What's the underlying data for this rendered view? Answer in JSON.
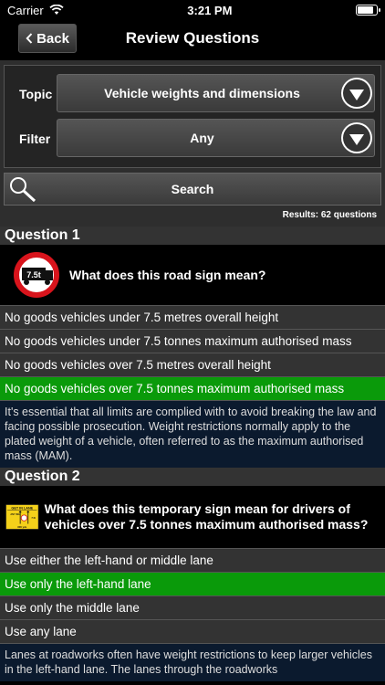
{
  "status": {
    "carrier": "Carrier",
    "time": "3:21 PM"
  },
  "nav": {
    "back_label": "Back",
    "title": "Review Questions"
  },
  "filters": {
    "topic_label": "Topic",
    "topic_value": "Vehicle weights and dimensions",
    "filter_label": "Filter",
    "filter_value": "Any"
  },
  "search": {
    "label": "Search"
  },
  "results_text": "Results: 62 questions",
  "questions": [
    {
      "header": "Question 1",
      "text": "What does this road sign mean?",
      "sign_text": "7.5t",
      "answers": [
        "No goods vehicles under 7.5 metres overall height",
        "No goods vehicles under 7.5 tonnes maximum authorised mass",
        "No goods vehicles over 7.5 metres overall height",
        "No goods vehicles over 7.5 tonnes maximum authorised mass"
      ],
      "correct_index": 3,
      "explanation": "It's essential that all limits are complied with to avoid breaking the law and facing possible prosecution. Weight restrictions normally apply to the plated weight of a vehicle, often referred to as the maximum authorised mass (MAM)."
    },
    {
      "header": "Question 2",
      "text": "What does this temporary sign mean for drivers of vehicles over 7.5 tonnes maximum authorised mass?",
      "sign_title": "GET IN LANE",
      "sign_sub_left": "ANY VEH",
      "sign_sub_right": "7.5t",
      "sign_distance": "800 yds",
      "answers": [
        "Use either the left-hand or middle lane",
        "Use only the left-hand lane",
        "Use only the middle lane",
        "Use any lane"
      ],
      "correct_index": 1,
      "explanation": "Lanes at roadworks often have weight restrictions to keep larger vehicles in the left-hand lane. The lanes through the roadworks"
    }
  ],
  "colors": {
    "correct": "#0a9a0a",
    "explanation_bg": "#0b1a2e",
    "sign_yellow": "#f4d11a",
    "sign_red": "#d8141c"
  }
}
